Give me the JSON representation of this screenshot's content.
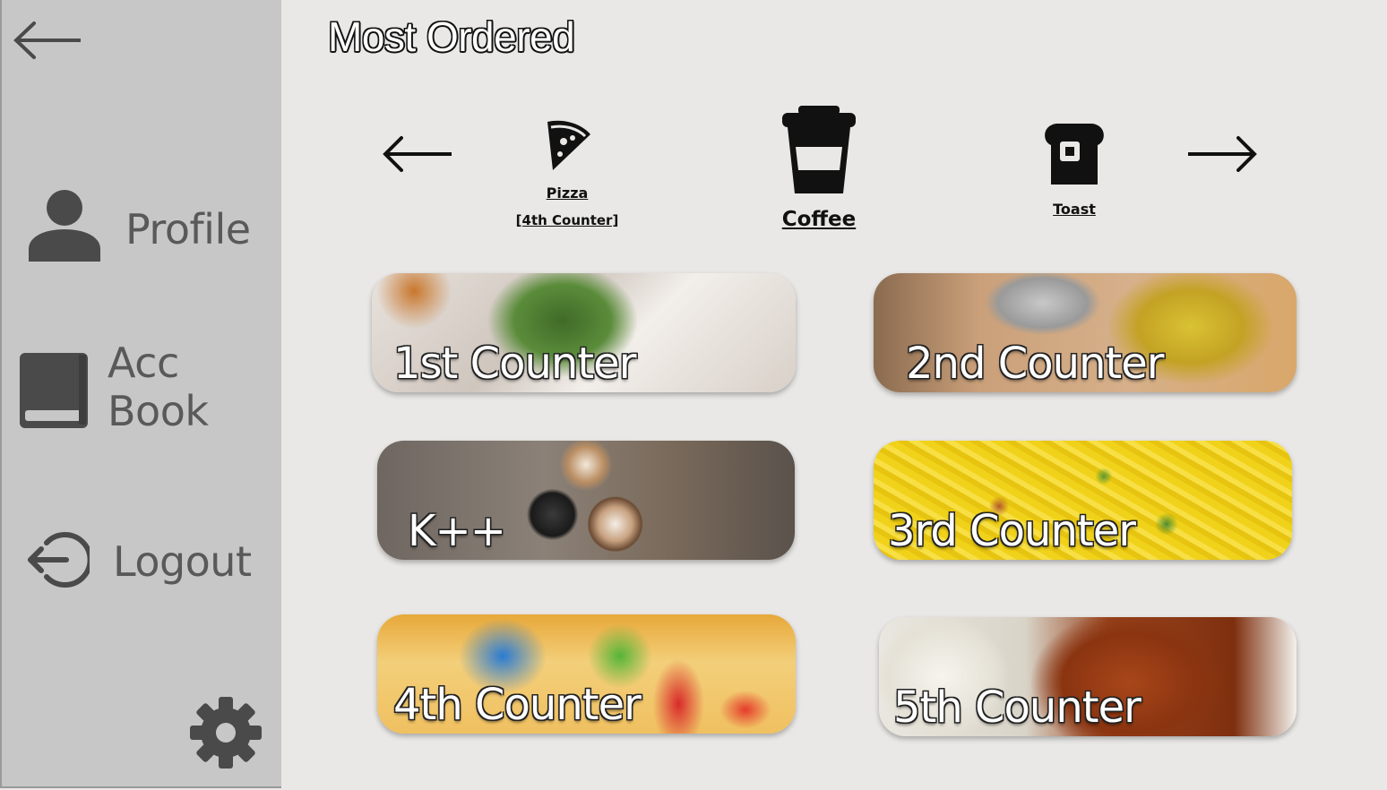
{
  "sidebar": {
    "items": [
      {
        "label": "Profile",
        "icon": "person-icon"
      },
      {
        "label": "Acc Book",
        "icon": "book-icon"
      },
      {
        "label": "Logout",
        "icon": "logout-icon"
      }
    ],
    "back_icon": "back-arrow-icon",
    "settings_icon": "gear-icon"
  },
  "main": {
    "title": "Most Ordered",
    "categories": [
      {
        "name": "Pizza",
        "sub": "[4th Counter]",
        "icon": "pizza-icon"
      },
      {
        "name": "Coffee",
        "icon": "coffee-cup-icon"
      },
      {
        "name": "Toast",
        "icon": "toast-icon"
      }
    ],
    "counters": [
      {
        "label": "1st Counter"
      },
      {
        "label": "2nd Counter"
      },
      {
        "label": "K++"
      },
      {
        "label": "3rd Counter"
      },
      {
        "label": "4th Counter"
      },
      {
        "label": "5th Counter"
      }
    ]
  },
  "colors": {
    "sidebar_bg": "#c7c7c7",
    "main_bg": "#e9e8e6",
    "sidebar_text": "#595959",
    "icon_dark": "#4a4a4a"
  }
}
